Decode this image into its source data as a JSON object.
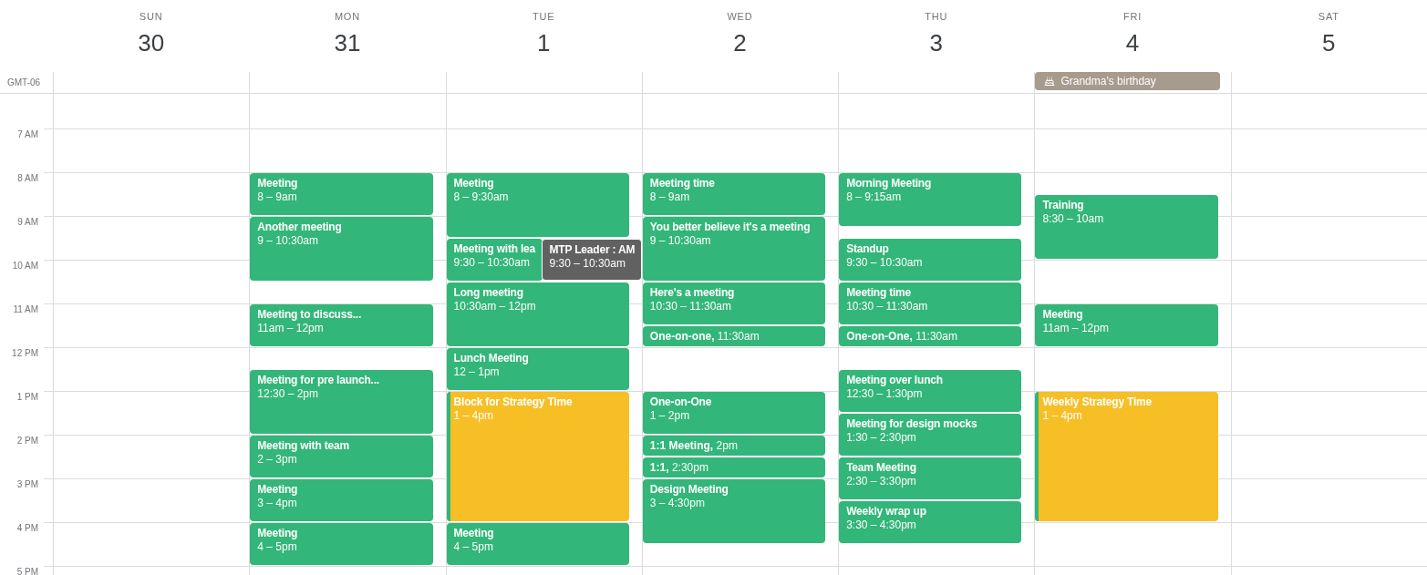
{
  "timezone": "GMT-06",
  "hours": [
    "7 AM",
    "8 AM",
    "9 AM",
    "10 AM",
    "11 AM",
    "12 PM",
    "1 PM",
    "2 PM",
    "3 PM",
    "4 PM",
    "5 PM"
  ],
  "days": [
    {
      "weekday": "SUN",
      "date": "30"
    },
    {
      "weekday": "MON",
      "date": "31",
      "events": [
        {
          "kind": "block",
          "title": "Meeting",
          "time": "8 – 9am",
          "color": "#33b679"
        },
        {
          "kind": "block",
          "title": "Another meeting",
          "time": "9 – 10:30am",
          "color": "#33b679"
        },
        {
          "kind": "block",
          "title": "Meeting to discuss...",
          "time": "11am – 12pm",
          "color": "#33b679"
        },
        {
          "kind": "block",
          "title": "Meeting for pre launch...",
          "time": "12:30 – 2pm",
          "color": "#33b679"
        },
        {
          "kind": "block",
          "title": "Meeting with team",
          "time": "2 – 3pm",
          "color": "#33b679"
        },
        {
          "kind": "block",
          "title": "Meeting",
          "time": "3 – 4pm",
          "color": "#33b679"
        },
        {
          "kind": "block",
          "title": "Meeting",
          "time": "4 – 5pm",
          "color": "#33b679"
        }
      ]
    },
    {
      "weekday": "TUE",
      "date": "1",
      "events": [
        {
          "kind": "block",
          "title": "Meeting",
          "time": "8 – 9:30am",
          "color": "#33b679"
        },
        {
          "kind": "partial",
          "title": "Meeting with lea",
          "time": "9:30 – 10:30am",
          "color": "#33b679"
        },
        {
          "kind": "overlay",
          "title": "MTP Leader : AM",
          "time": "9:30 – 10:30am",
          "color": "#616161"
        },
        {
          "kind": "block",
          "title": "Long meeting",
          "time": "10:30am – 12pm",
          "color": "#33b679"
        },
        {
          "kind": "block",
          "title": "Lunch Meeting",
          "time": "12 – 1pm",
          "color": "#33b679"
        },
        {
          "kind": "striped",
          "title": "Block for Strategy Time",
          "time": "1 – 4pm",
          "color": "#f6bf26"
        },
        {
          "kind": "block",
          "title": "Meeting",
          "time": "4 – 5pm",
          "color": "#33b679"
        }
      ]
    },
    {
      "weekday": "WED",
      "date": "2",
      "events": [
        {
          "kind": "block",
          "title": "Meeting time",
          "time": "8 – 9am",
          "color": "#33b679"
        },
        {
          "kind": "block",
          "title": "You better believe it's a meeting",
          "time": "9 – 10:30am",
          "color": "#33b679"
        },
        {
          "kind": "block",
          "title": "Here's a meeting",
          "time": "10:30 – 11:30am",
          "color": "#33b679"
        },
        {
          "kind": "compact",
          "title": "One-on-one,",
          "time": "11:30am",
          "color": "#33b679"
        },
        {
          "kind": "block",
          "title": "One-on-One",
          "time": "1 – 2pm",
          "color": "#33b679"
        },
        {
          "kind": "compact",
          "title": "1:1 Meeting,",
          "time": "2pm",
          "color": "#33b679"
        },
        {
          "kind": "compact",
          "title": "1:1,",
          "time": "2:30pm",
          "color": "#33b679"
        },
        {
          "kind": "block",
          "title": "Design Meeting",
          "time": "3 – 4:30pm",
          "color": "#33b679"
        }
      ]
    },
    {
      "weekday": "THU",
      "date": "3",
      "events": [
        {
          "kind": "block",
          "title": "Morning Meeting",
          "time": "8 – 9:15am",
          "color": "#33b679"
        },
        {
          "kind": "block",
          "title": "Standup",
          "time": "9:30 – 10:30am",
          "color": "#33b679"
        },
        {
          "kind": "block",
          "title": "Meeting time",
          "time": "10:30 – 11:30am",
          "color": "#33b679"
        },
        {
          "kind": "compact",
          "title": "One-on-One,",
          "time": "11:30am",
          "color": "#33b679"
        },
        {
          "kind": "block",
          "title": "Meeting over lunch",
          "time": "12:30 – 1:30pm",
          "color": "#33b679"
        },
        {
          "kind": "block",
          "title": "Meeting for design mocks",
          "time": "1:30 – 2:30pm",
          "color": "#33b679"
        },
        {
          "kind": "block",
          "title": "Team Meeting",
          "time": "2:30 – 3:30pm",
          "color": "#33b679"
        },
        {
          "kind": "block",
          "title": "Weekly wrap up",
          "time": "3:30 – 4:30pm",
          "color": "#33b679"
        }
      ]
    },
    {
      "weekday": "FRI",
      "date": "4",
      "all_day": [
        {
          "title": "Grandma's birthday",
          "color": "#a79b8e"
        }
      ],
      "events": [
        {
          "kind": "block",
          "title": "Training",
          "time": "8:30 – 10am",
          "color": "#33b679"
        },
        {
          "kind": "block",
          "title": "Meeting",
          "time": "11am – 12pm",
          "color": "#33b679"
        },
        {
          "kind": "striped",
          "title": "Weekly Strategy Time",
          "time": "1 – 4pm",
          "color": "#f6bf26"
        }
      ]
    },
    {
      "weekday": "SAT",
      "date": "5"
    }
  ]
}
